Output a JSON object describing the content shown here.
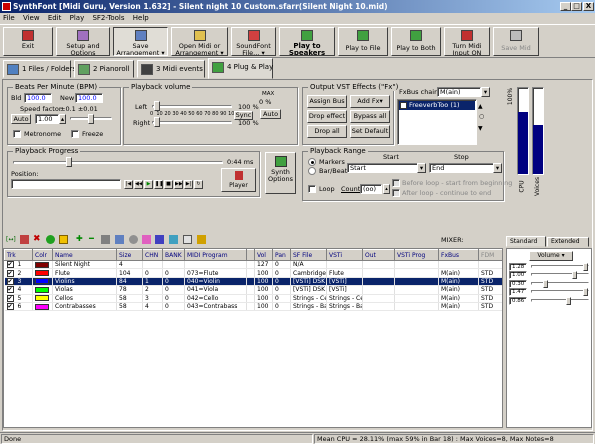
{
  "window": {
    "title": "SynthFont [Midi Guru, Version 1.632] - Silent night 10 Custom.sfarr(Silent Night 10.mid)",
    "min": "_",
    "max": "□",
    "close": "X"
  },
  "menu": [
    "File",
    "View",
    "Edit",
    "Play",
    "SF2-Tools",
    "Help"
  ],
  "toolbar": [
    {
      "label": "Exit",
      "icon": "exit-icon"
    },
    {
      "label": "Setup and Options",
      "icon": "setup-icon"
    },
    {
      "label": "Save Arrangement ▾",
      "icon": "save-icon"
    },
    {
      "label": "Open Midi or Arrangement ▾",
      "icon": "open-icon"
    },
    {
      "label": "SoundFont File... ▾",
      "icon": "soundfont-icon"
    },
    {
      "label": "Play to Speakers",
      "icon": "speaker-icon"
    },
    {
      "label": "Play to File",
      "icon": "file-icon"
    },
    {
      "label": "Play to Both",
      "icon": "both-icon"
    },
    {
      "label": "Turn Midi Input ON",
      "icon": "midi-input-icon"
    },
    {
      "label": "Save Mid",
      "icon": "save-mid-icon"
    }
  ],
  "tabs": [
    "1 Files / Folders",
    "2 Pianoroll",
    "3 Midi events",
    "4 Plug & Play"
  ],
  "bpm": {
    "title": "Beats Per Minute (BPM)",
    "old_label": "Bld",
    "old": "100.0",
    "new_label": "New",
    "new": "100.0",
    "speed_label": "Speed factor",
    "speed_range": "±0.1  ±0.01",
    "auto": "Auto",
    "factor": "1.00",
    "metronome": "Metronome",
    "freeze": "Freeze"
  },
  "volume": {
    "title": "Playback volume",
    "left": "Left",
    "right": "Right",
    "scale": [
      "0",
      "10",
      "20",
      "30",
      "40",
      "50",
      "60",
      "70",
      "80",
      "90",
      "100"
    ],
    "left_pct": "100 %",
    "right_pct": "100 %",
    "sync": "Sync",
    "max_label": "MAX",
    "max_value": "0 %",
    "auto": "Auto"
  },
  "vst": {
    "title": "Output VST Effects (\"Fx\")",
    "buttons": [
      "Assign Bus",
      "Add Fx▾",
      "Drop effect",
      "Bypass all",
      "Drop all",
      "Set Default"
    ],
    "fxbus_label": "FxBus chain",
    "fxbus_value": "M(ain)",
    "fx_item": "FreeverbToo (1)"
  },
  "meter": {
    "top": "100%",
    "cpu": "CPU",
    "voices": "Voices",
    "cpu_level": 0.72,
    "voices_level": 0.57
  },
  "progress": {
    "title": "Playback Progress",
    "time": "0:44 ms",
    "position_label": "Position:",
    "player": "Player"
  },
  "synth_options": "Synth Options",
  "range": {
    "title": "Playback Range",
    "markers": "Markers",
    "barbeat": "Bar/Beat",
    "start_label": "Start",
    "stop_label": "Stop",
    "start": "Start",
    "stop": "End",
    "loop": "Loop",
    "count_label": "Count:",
    "count": "(oo)",
    "before_loop": "Before loop - start from beginning",
    "after_loop": "After loop - continue to end"
  },
  "mixer": {
    "label": "MIXER:",
    "tab_standard": "Standard",
    "tab_extended": "Extended",
    "volume_btn": "Volume ▾",
    "values": [
      "1.28",
      "1.00",
      "0.30",
      "1.47",
      "0.86"
    ],
    "levels": [
      1.0,
      0.78,
      0.23,
      1.0,
      0.67
    ]
  },
  "table": {
    "headers": [
      "Trk",
      "Colr",
      "Name",
      "Size",
      "CHN",
      "BANK",
      "MIDI Program",
      "",
      "Vol",
      "Pan",
      "SF File",
      "VSTi",
      "Out",
      "VSTi Prog",
      "FxBus",
      "FDM"
    ],
    "rows": [
      {
        "trk": "1",
        "color": "#800000",
        "name": "Silent Night",
        "size": "4",
        "chn": "",
        "bank": "",
        "prog": "",
        "vol": "127",
        "pan": "0",
        "sf": "N/A",
        "vsti": "",
        "out": "",
        "vprog": "",
        "fx": "",
        "fdm": ""
      },
      {
        "trk": "2",
        "color": "#ff0000",
        "name": "Flute",
        "size": "104",
        "chn": "0",
        "bank": "0",
        "prog": "073=Flute",
        "vol": "100",
        "pan": "0",
        "sf": "Cambridge_Concert_Flute.SF2",
        "vsti": "Flute",
        "out": "",
        "vprog": "",
        "fx": "M(ain)",
        "fdm": "STD"
      },
      {
        "trk": "3",
        "color": "#0000ff",
        "name": "Violins",
        "size": "84",
        "chn": "1",
        "bank": "0",
        "prog": "040=Violin",
        "vol": "100",
        "pan": "0",
        "sf": "[VSTi] DSK Strings(1)",
        "vsti": "[VSTi]",
        "out": "",
        "vprog": "",
        "fx": "M(ain)",
        "fdm": "STD"
      },
      {
        "trk": "4",
        "color": "#00ff00",
        "name": "Violas",
        "size": "78",
        "chn": "2",
        "bank": "0",
        "prog": "041=Viola",
        "vol": "100",
        "pan": "0",
        "sf": "[VSTi] DSK Strings(2)",
        "vsti": "[VSTi]",
        "out": "",
        "vprog": "",
        "fx": "M(ain)",
        "fdm": "STD"
      },
      {
        "trk": "5",
        "color": "#ffff00",
        "name": "Cellos",
        "size": "58",
        "chn": "3",
        "bank": "0",
        "prog": "042=Cello",
        "vol": "100",
        "pan": "0",
        "sf": "Strings - Celli Sustain.sfz",
        "vsti": "Strings - Celli",
        "out": "",
        "vprog": "",
        "fx": "M(ain)",
        "fdm": "STD"
      },
      {
        "trk": "6",
        "color": "#ff00ff",
        "name": "Contrabasses",
        "size": "58",
        "chn": "4",
        "bank": "0",
        "prog": "043=Contrabass",
        "vol": "100",
        "pan": "0",
        "sf": "Strings - Basses Sustain.sfz",
        "vsti": "Strings - Basses",
        "out": "",
        "vprog": "",
        "fx": "M(ain)",
        "fdm": "STD"
      }
    ]
  },
  "status": {
    "left": "Done",
    "cpu": "Mean CPU = 28.11% (max 59% in Bar 18) : Max Voices=8, Max Notes=8"
  }
}
